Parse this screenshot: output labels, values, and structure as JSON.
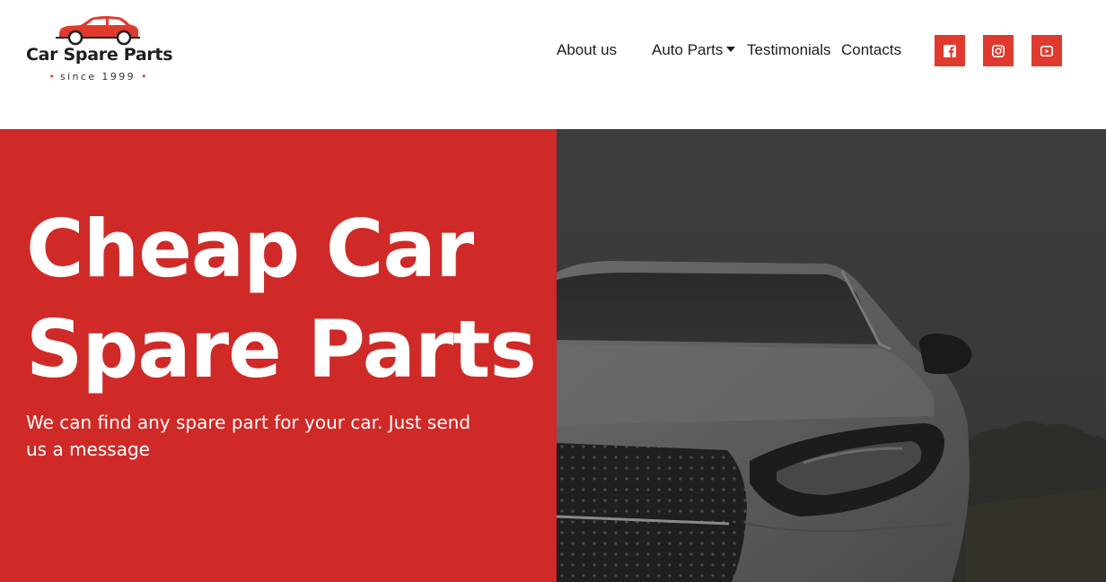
{
  "header": {
    "logo": {
      "name": "Car Spare Parts",
      "tagline": "since 1999",
      "icon": "car-icon",
      "accent": "#e03a2e"
    },
    "nav": [
      {
        "label": "About us"
      },
      {
        "label": "Auto Parts",
        "icon": "caret-down-icon"
      },
      {
        "label": "Testimonials"
      },
      {
        "label": "Contacts"
      }
    ],
    "social": [
      {
        "icon": "facebook-icon"
      },
      {
        "icon": "instagram-icon"
      },
      {
        "icon": "youtube-icon"
      }
    ]
  },
  "hero": {
    "title": "Cheap Car Spare Parts",
    "subtitle": "We can find any spare part for your car. Just send us a message",
    "background_color": "#cf2a27",
    "image": "car-photo"
  }
}
